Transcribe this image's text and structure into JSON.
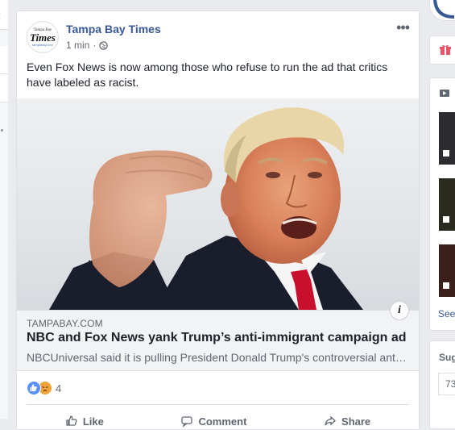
{
  "post": {
    "page_name": "Tampa Bay Times",
    "logo_small": "Tampa Bay",
    "logo_main": "Times",
    "logo_url": "tampabay.com",
    "timestamp": "1 min",
    "separator": "·",
    "more_label": "•••",
    "text": "Even Fox News is now among those who refuse to run the ad that critics have labeled as racist.",
    "link": {
      "domain": "TAMPABAY.COM",
      "title": "NBC and Fox News yank Trump’s anti-immigrant campaign ad",
      "description": "NBCUniversal said it is pulling President Donald Trump's controversial anti-immigrant ad"
    },
    "info_label": "i",
    "reactions": {
      "count": "4",
      "types": [
        "like-icon",
        "angry-icon"
      ]
    },
    "actions": [
      {
        "label": "Like",
        "icon": "thumbs-up-icon"
      },
      {
        "label": "Comment",
        "icon": "comment-icon"
      },
      {
        "label": "Share",
        "icon": "share-icon"
      }
    ]
  },
  "left_sidebar": {
    "glyph": "t"
  },
  "right_sidebar": {
    "see_label": "See",
    "suggested_label": "Sug",
    "suggested_value": "73"
  },
  "colors": {
    "link_blue": "#385898",
    "like_blue": "#5890ff",
    "angry_orange": "#f0a33a",
    "tie_red": "#c8102e"
  }
}
